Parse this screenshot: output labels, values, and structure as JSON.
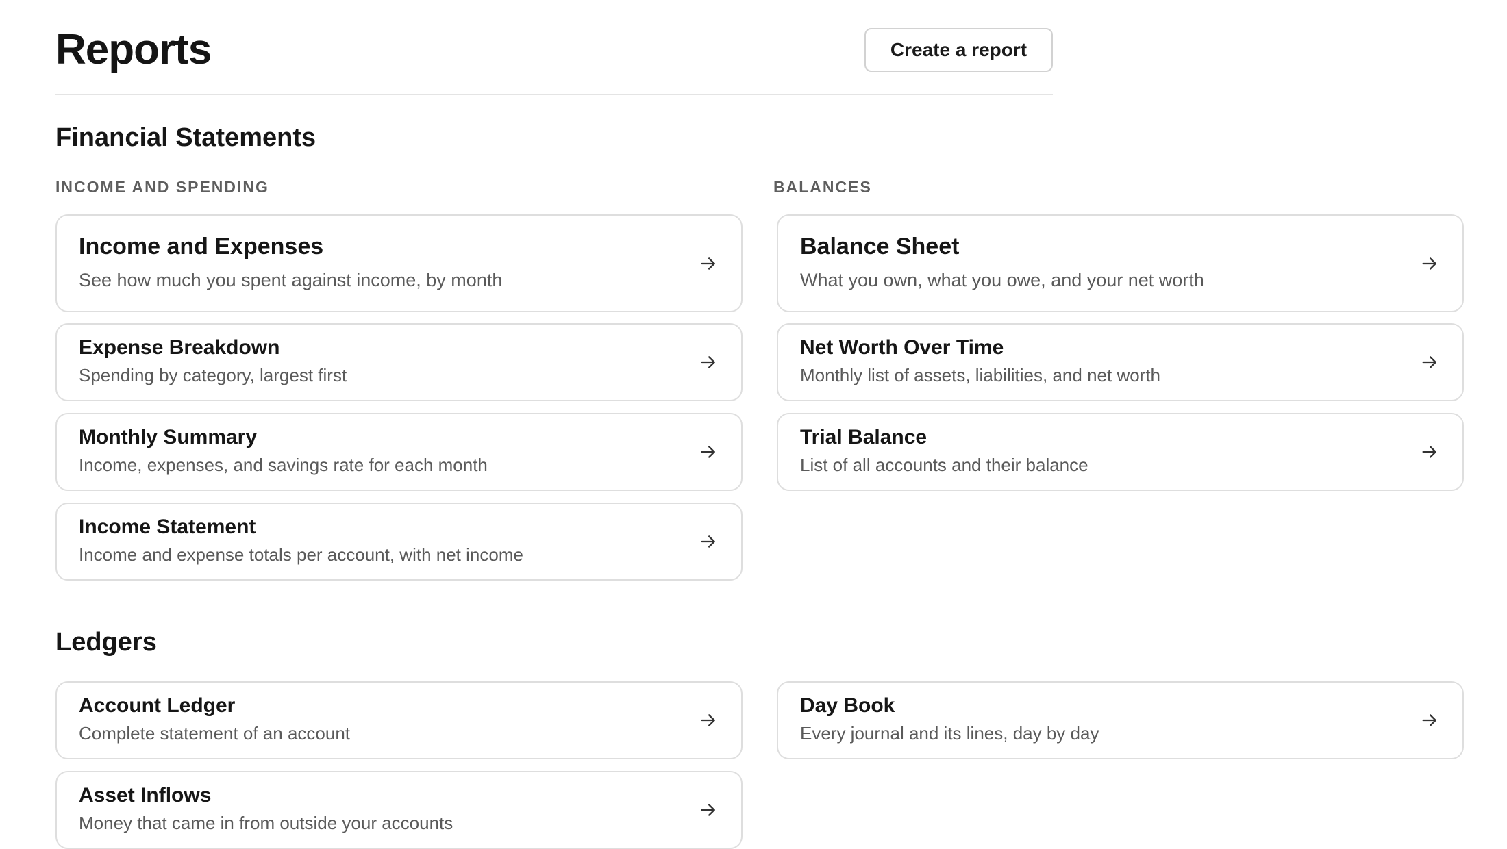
{
  "header": {
    "title": "Reports",
    "create_label": "Create a report"
  },
  "sections": {
    "financial": {
      "title": "Financial Statements",
      "income_group_label": "INCOME AND SPENDING",
      "balances_group_label": "BALANCES",
      "income_cards": [
        {
          "title": "Income and Expenses",
          "description": "See how much you spent against income, by month"
        },
        {
          "title": "Expense Breakdown",
          "description": "Spending by category, largest first"
        },
        {
          "title": "Monthly Summary",
          "description": "Income, expenses, and savings rate for each month"
        },
        {
          "title": "Income Statement",
          "description": "Income and expense totals per account, with net income"
        }
      ],
      "balance_cards": [
        {
          "title": "Balance Sheet",
          "description": "What you own, what you owe, and your net worth"
        },
        {
          "title": "Net Worth Over Time",
          "description": "Monthly list of assets, liabilities, and net worth"
        },
        {
          "title": "Trial Balance",
          "description": "List of all accounts and their balance"
        }
      ]
    },
    "ledgers": {
      "title": "Ledgers",
      "left_cards": [
        {
          "title": "Account Ledger",
          "description": "Complete statement of an account"
        },
        {
          "title": "Asset Inflows",
          "description": "Money that came in from outside your accounts"
        }
      ],
      "right_cards": [
        {
          "title": "Day Book",
          "description": "Every journal and its lines, day by day"
        }
      ]
    }
  },
  "icons": {
    "card_arrow": "arrow-right-icon"
  },
  "colors": {
    "text": "#161616",
    "muted": "#5a5a5a",
    "border": "#dedede"
  }
}
